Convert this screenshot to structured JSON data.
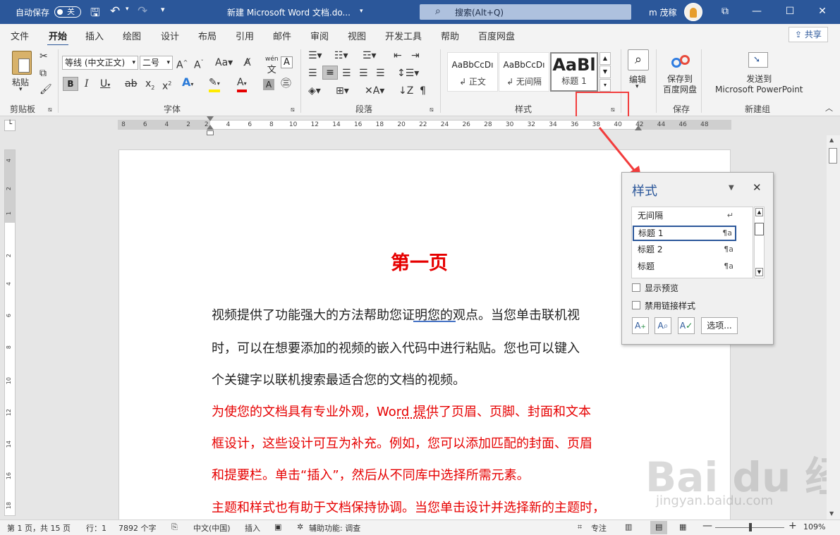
{
  "titlebar": {
    "autosave_label": "自动保存",
    "autosave_state": "关",
    "document_title": "新建 Microsoft Word 文档.do...",
    "search_placeholder": "搜索(Alt+Q)",
    "user_name": "m 茂稼"
  },
  "tabs": [
    "文件",
    "开始",
    "插入",
    "绘图",
    "设计",
    "布局",
    "引用",
    "邮件",
    "审阅",
    "视图",
    "开发工具",
    "帮助",
    "百度网盘"
  ],
  "share_label": "共享",
  "ribbon": {
    "clipboard": {
      "paste": "粘贴",
      "group": "剪贴板"
    },
    "font": {
      "name": "等线 (中文正文)",
      "size": "二号",
      "group": "字体",
      "wen": "wén\n文"
    },
    "paragraph": {
      "group": "段落"
    },
    "styles": {
      "group": "样式",
      "items": [
        {
          "preview": "AaBbCcDı",
          "name": "↲ 正文"
        },
        {
          "preview": "AaBbCcDı",
          "name": "↲ 无间隔"
        },
        {
          "preview": "AaBl",
          "name": "标题 1"
        }
      ]
    },
    "editing": {
      "label": "编辑"
    },
    "save": {
      "label": "保存到\n百度网盘",
      "group": "保存"
    },
    "newgroup": {
      "label": "发送到\nMicrosoft PowerPoint",
      "group": "新建组"
    }
  },
  "ruler_numbers": [
    "8",
    "6",
    "4",
    "2",
    "2",
    "4",
    "6",
    "8",
    "10",
    "12",
    "14",
    "16",
    "18",
    "20",
    "22",
    "24",
    "26",
    "28",
    "30",
    "32",
    "34",
    "36",
    "38",
    "40",
    "42",
    "44",
    "46",
    "48"
  ],
  "vruler_numbers": [
    "4",
    "2",
    "1",
    "2",
    "4",
    "6",
    "8",
    "10",
    "12",
    "14",
    "16",
    "18"
  ],
  "document": {
    "title": "第一页",
    "paragraphs": [
      {
        "text": "视频提供了功能强大的方法帮助您证明您的观点。当您单击联机视",
        "color": "#222222"
      },
      {
        "text": "时，可以在想要添加的视频的嵌入代码中进行粘贴。您也可以键入",
        "color": "#222222"
      },
      {
        "text": "个关键字以联机搜索最适合您的文档的视频。",
        "color": "#222222"
      },
      {
        "text": "为使您的文档具有专业外观，Word 提供了页眉、页脚、封面和文本",
        "color": "#e60000"
      },
      {
        "text": "框设计，这些设计可互为补充。例如，您可以添加匹配的封面、页眉",
        "color": "#e60000"
      },
      {
        "text": "和提要栏。单击“插入”，然后从不同库中选择所需元素。",
        "color": "#e60000"
      },
      {
        "text": "主题和样式也有助于文档保持协调。当您单击设计并选择新的主题时，",
        "color": "#e60000"
      }
    ]
  },
  "styles_pane": {
    "title": "样式",
    "items": [
      {
        "name": "无间隔",
        "mark": "↵"
      },
      {
        "name": "标题 1",
        "mark": "¶a"
      },
      {
        "name": "标题 2",
        "mark": "¶a"
      },
      {
        "name": "标题",
        "mark": "¶a"
      }
    ],
    "show_preview": "显示预览",
    "disable_linked": "禁用链接样式",
    "options_button": "选项..."
  },
  "statusbar": {
    "page": "第 1 页，共 15 页",
    "row": "行：1",
    "words": "7892 个字",
    "language": "中文(中国)",
    "mode": "插入",
    "accessibility": "辅助功能: 调查",
    "focus": "专注",
    "zoom": "109%"
  },
  "watermark": {
    "main": "Bai du 经验",
    "sub": "jingyan.baidu.com"
  }
}
